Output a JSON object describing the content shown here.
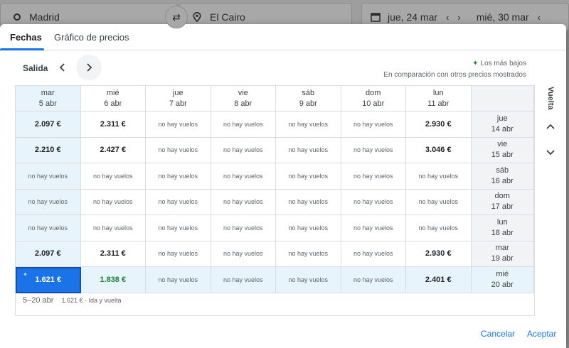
{
  "search": {
    "origin": "Madrid",
    "destination": "El Cairo",
    "depart_date": "jue, 24 mar",
    "return_date": "mié, 30 mar"
  },
  "tabs": [
    {
      "label": "Fechas",
      "active": true
    },
    {
      "label": "Gráfico de precios",
      "active": false
    }
  ],
  "controls": {
    "salida_label": "Salida",
    "vuelta_label": "Vuelta"
  },
  "legend": {
    "lowest_label": "Los más bajos",
    "comparison_note": "En comparación con otros precios mostrados"
  },
  "columns": [
    {
      "day": "mar",
      "date": "5 abr",
      "selected": true
    },
    {
      "day": "mié",
      "date": "6 abr",
      "selected": false
    },
    {
      "day": "jue",
      "date": "7 abr",
      "selected": false
    },
    {
      "day": "vie",
      "date": "8 abr",
      "selected": false
    },
    {
      "day": "sáb",
      "date": "9 abr",
      "selected": false
    },
    {
      "day": "dom",
      "date": "10 abr",
      "selected": false
    },
    {
      "day": "lun",
      "date": "11 abr",
      "selected": false
    }
  ],
  "rows": [
    {
      "day": "jue",
      "date": "14 abr",
      "selected": false,
      "cells": [
        "2.097 €",
        "2.311 €",
        "no hay vuelos",
        "no hay vuelos",
        "no hay vuelos",
        "no hay vuelos",
        "2.930 €"
      ]
    },
    {
      "day": "vie",
      "date": "15 abr",
      "selected": false,
      "cells": [
        "2.210 €",
        "2.427 €",
        "no hay vuelos",
        "no hay vuelos",
        "no hay vuelos",
        "no hay vuelos",
        "3.046 €"
      ]
    },
    {
      "day": "sáb",
      "date": "16 abr",
      "selected": false,
      "cells": [
        "no hay vuelos",
        "no hay vuelos",
        "no hay vuelos",
        "no hay vuelos",
        "no hay vuelos",
        "no hay vuelos",
        "no hay vuelos"
      ]
    },
    {
      "day": "dom",
      "date": "17 abr",
      "selected": false,
      "cells": [
        "no hay vuelos",
        "no hay vuelos",
        "no hay vuelos",
        "no hay vuelos",
        "no hay vuelos",
        "no hay vuelos",
        "no hay vuelos"
      ]
    },
    {
      "day": "lun",
      "date": "18 abr",
      "selected": false,
      "cells": [
        "no hay vuelos",
        "no hay vuelos",
        "no hay vuelos",
        "no hay vuelos",
        "no hay vuelos",
        "no hay vuelos",
        "no hay vuelos"
      ]
    },
    {
      "day": "mar",
      "date": "19 abr",
      "selected": false,
      "cells": [
        "2.097 €",
        "2.311 €",
        "no hay vuelos",
        "no hay vuelos",
        "no hay vuelos",
        "no hay vuelos",
        "2.930 €"
      ]
    },
    {
      "day": "mié",
      "date": "20 abr",
      "selected": true,
      "cells": [
        "1.621 €",
        "1.838 €",
        "no hay vuelos",
        "no hay vuelos",
        "no hay vuelos",
        "no hay vuelos",
        "2.401 €"
      ]
    }
  ],
  "selection": {
    "range": "5–20 abr",
    "price_note": "1.621 € · Ida y vuelta"
  },
  "actions": {
    "cancel_label": "Cancelar",
    "accept_label": "Aceptar"
  },
  "colors": {
    "accent": "#1a73e8",
    "lowest_price_green": "#188038",
    "selected_bg": "#e8f4fb"
  }
}
